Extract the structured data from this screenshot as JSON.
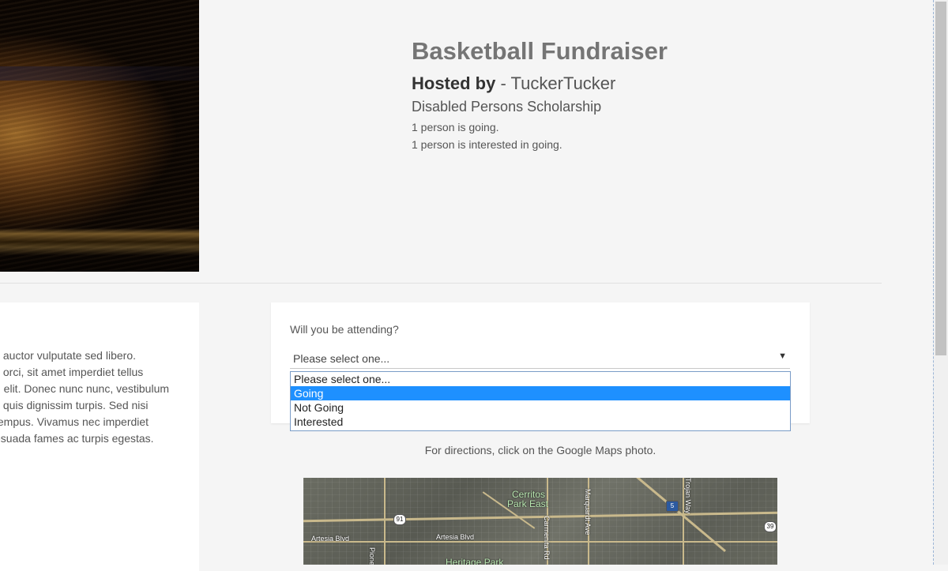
{
  "event": {
    "title": "Basketball Fundraiser",
    "hosted_prefix": "Hosted by",
    "host": "- TuckerTucker",
    "organization": "Disabled Persons Scholarship",
    "going_text": "1 person is going.",
    "interested_text": "1 person is interested in going."
  },
  "description": {
    "lines": [
      "s auctor vulputate sed libero.",
      "s orci, sit amet imperdiet tellus",
      "g elit. Donec nunc nunc, vestibulum",
      "s quis dignissim turpis. Sed nisi",
      " tempus. Vivamus nec imperdiet",
      "esuada fames ac turpis egestas."
    ]
  },
  "attendance": {
    "question": "Will you be attending?",
    "selected": "Please select one...",
    "options": [
      "Please select one...",
      "Going",
      "Not Going",
      "Interested"
    ],
    "highlighted_option": "Going"
  },
  "directions": {
    "text": "For directions, click on the Google Maps photo."
  },
  "map": {
    "labels": {
      "park_east": "Cerritos",
      "park_east_2": "Park East",
      "artesia1": "Artesia Blvd",
      "artesia2": "Artesia Blvd",
      "heritage": "Heritage Park",
      "pioneer": "Pioneer Blvd",
      "carmenita": "Carmenita Rd",
      "marquardt": "Marquardt Ave",
      "trojan": "Trojan Way",
      "hwy91": "91",
      "hwy5": "5",
      "hwy39": "39"
    }
  }
}
